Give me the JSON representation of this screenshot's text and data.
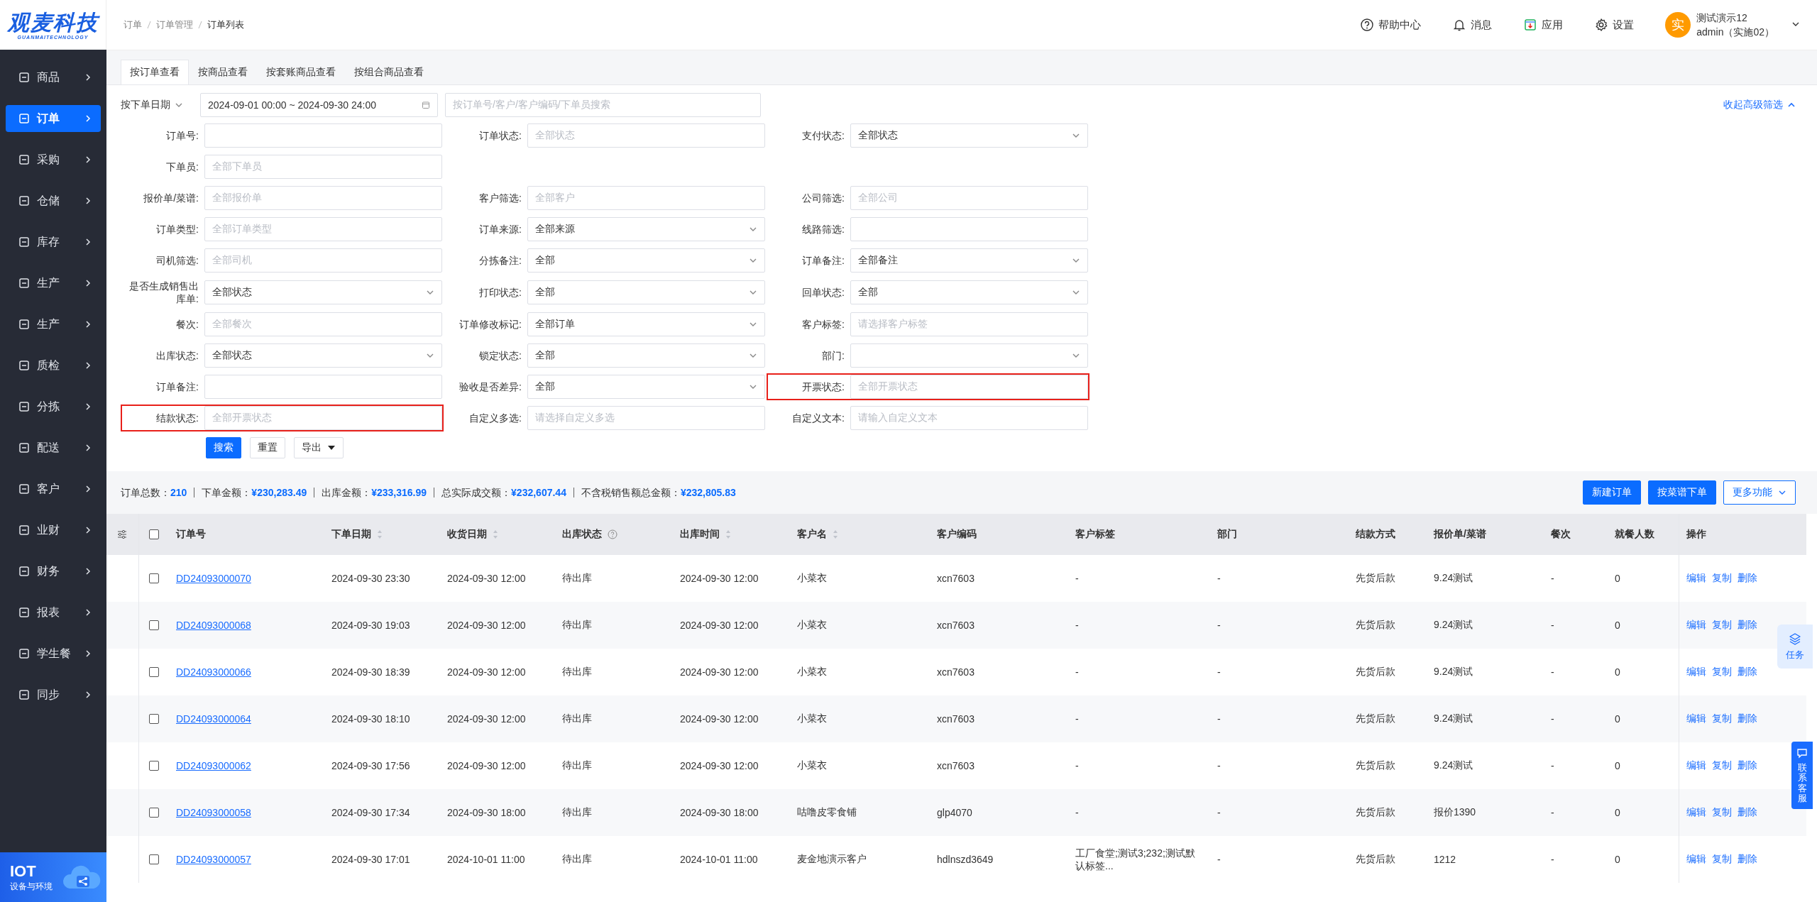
{
  "logo": {
    "title": "观麦科技",
    "subtitle": "GUANMAITECHNOLOGY"
  },
  "sidebar": {
    "items": [
      {
        "label": "商品",
        "selected": false
      },
      {
        "label": "订单",
        "selected": true
      },
      {
        "label": "采购",
        "selected": false
      },
      {
        "label": "仓储",
        "selected": false
      },
      {
        "label": "库存",
        "selected": false
      },
      {
        "label": "生产",
        "selected": false
      },
      {
        "label": "生产",
        "selected": false
      },
      {
        "label": "质检",
        "selected": false
      },
      {
        "label": "分拣",
        "selected": false
      },
      {
        "label": "配送",
        "selected": false
      },
      {
        "label": "客户",
        "selected": false
      },
      {
        "label": "业财",
        "selected": false
      },
      {
        "label": "财务",
        "selected": false
      },
      {
        "label": "报表",
        "selected": false
      },
      {
        "label": "学生餐",
        "selected": false
      },
      {
        "label": "同步",
        "selected": false
      }
    ],
    "iot": {
      "title": "IOT",
      "subtitle": "设备与环境"
    }
  },
  "breadcrumbs": [
    "订单",
    "订单管理",
    "订单列表"
  ],
  "header_actions": [
    {
      "kind": "help",
      "label": "帮助中心"
    },
    {
      "kind": "bell",
      "label": "消息"
    },
    {
      "kind": "app",
      "label": "应用"
    },
    {
      "kind": "gear",
      "label": "设置"
    }
  ],
  "user": {
    "avatar": "实",
    "name": "测试演示12",
    "account": "admin（实施02）"
  },
  "tabs": [
    {
      "label": "按订单查看",
      "selected": true
    },
    {
      "label": "按商品查看",
      "selected": false
    },
    {
      "label": "按套账商品查看",
      "selected": false
    },
    {
      "label": "按组合商品查看",
      "selected": false
    }
  ],
  "search_bar": {
    "date_type": "按下单日期",
    "date_range": "2024-09-01 00:00 ~ 2024-09-30 24:00",
    "placeholder": "按订单号/客户/客户编码/下单员搜索",
    "collapse_link": "收起高级筛选"
  },
  "filters": {
    "rows": [
      {
        "fields": [
          {
            "label": "订单号:",
            "kind": "input",
            "highlighted": false
          },
          {
            "label": "订单状态:",
            "kind": "input",
            "placeholder": "全部状态",
            "highlighted": false
          },
          {
            "label": "支付状态:",
            "kind": "select",
            "value": "全部状态",
            "highlighted": false
          }
        ]
      },
      {
        "fields": [
          {
            "label": "下单员:",
            "kind": "input",
            "placeholder": "全部下单员",
            "highlighted": false
          }
        ]
      },
      {
        "fields": [
          {
            "label": "报价单/菜谱:",
            "kind": "input",
            "placeholder": "全部报价单",
            "highlighted": false
          },
          {
            "label": "客户筛选:",
            "kind": "input",
            "placeholder": "全部客户",
            "highlighted": false
          },
          {
            "label": "公司筛选:",
            "kind": "input",
            "placeholder": "全部公司",
            "highlighted": false
          }
        ]
      },
      {
        "fields": [
          {
            "label": "订单类型:",
            "kind": "input",
            "placeholder": "全部订单类型",
            "highlighted": false
          },
          {
            "label": "订单来源:",
            "kind": "select",
            "value": "全部来源",
            "highlighted": false
          },
          {
            "label": "线路筛选:",
            "kind": "input",
            "highlighted": false
          }
        ]
      },
      {
        "fields": [
          {
            "label": "司机筛选:",
            "kind": "input",
            "placeholder": "全部司机",
            "highlighted": false
          },
          {
            "label": "分拣备注:",
            "kind": "select",
            "value": "全部",
            "highlighted": false
          },
          {
            "label": "订单备注:",
            "kind": "select",
            "value": "全部备注",
            "highlighted": false
          }
        ]
      },
      {
        "fields": [
          {
            "label": "是否生成销售出库单:",
            "kind": "select",
            "value": "全部状态",
            "highlighted": false
          },
          {
            "label": "打印状态:",
            "kind": "select",
            "value": "全部",
            "highlighted": false
          },
          {
            "label": "回单状态:",
            "kind": "select",
            "value": "全部",
            "highlighted": false
          }
        ]
      },
      {
        "fields": [
          {
            "label": "餐次:",
            "kind": "input",
            "placeholder": "全部餐次",
            "highlighted": false
          },
          {
            "label": "订单修改标记:",
            "kind": "select",
            "value": "全部订单",
            "highlighted": false
          },
          {
            "label": "客户标签:",
            "kind": "input",
            "placeholder": "请选择客户标签",
            "highlighted": false
          }
        ]
      },
      {
        "fields": [
          {
            "label": "出库状态:",
            "kind": "select",
            "value": "全部状态",
            "highlighted": false
          },
          {
            "label": "锁定状态:",
            "kind": "select",
            "value": "全部",
            "highlighted": false
          },
          {
            "label": "部门:",
            "kind": "select",
            "highlighted": false
          }
        ]
      },
      {
        "fields": [
          {
            "label": "订单备注:",
            "kind": "input",
            "highlighted": false
          },
          {
            "label": "验收是否差异:",
            "kind": "select",
            "value": "全部",
            "highlighted": false
          },
          {
            "label": "开票状态:",
            "kind": "input",
            "placeholder": "全部开票状态",
            "highlighted": true
          }
        ]
      },
      {
        "fields": [
          {
            "label": "结款状态:",
            "kind": "input",
            "placeholder": "全部开票状态",
            "highlighted": true
          },
          {
            "label": "自定义多选:",
            "kind": "input",
            "placeholder": "请选择自定义多选",
            "highlighted": false
          },
          {
            "label": "自定义文本:",
            "kind": "input",
            "placeholder": "请输入自定义文本",
            "highlighted": false
          }
        ]
      }
    ],
    "buttons": [
      {
        "kind": "primary",
        "label": "搜索"
      },
      {
        "kind": "default",
        "label": "重置"
      },
      {
        "kind": "dropdown",
        "label": "导出"
      }
    ]
  },
  "summary": [
    {
      "label": "订单总数：",
      "value": "210"
    },
    {
      "label": "下单金额：",
      "value": "¥230,283.49"
    },
    {
      "label": "出库金额：",
      "value": "¥233,316.99"
    },
    {
      "label": "总实际成交额：",
      "value": "¥232,607.44"
    },
    {
      "label": "不含税销售额总金额：",
      "value": "¥232,805.83"
    }
  ],
  "toolbar_buttons": [
    {
      "kind": "primary",
      "label": "新建订单"
    },
    {
      "kind": "primary",
      "label": "按菜谱下单"
    },
    {
      "kind": "outline",
      "label": "更多功能"
    }
  ],
  "table": {
    "select_all_checked": false,
    "columns": [
      {
        "label": "订单号",
        "sortable": false,
        "help": false
      },
      {
        "label": "下单日期",
        "sortable": true,
        "help": false
      },
      {
        "label": "收货日期",
        "sortable": true,
        "help": false
      },
      {
        "label": "出库状态",
        "sortable": false,
        "help": true
      },
      {
        "label": "出库时间",
        "sortable": true,
        "help": false
      },
      {
        "label": "客户名",
        "sortable": true,
        "help": false
      },
      {
        "label": "客户编码",
        "sortable": false,
        "help": false
      },
      {
        "label": "客户标签",
        "sortable": false,
        "help": false
      },
      {
        "label": "部门",
        "sortable": false,
        "help": false
      },
      {
        "label": "结款方式",
        "sortable": false,
        "help": false
      },
      {
        "label": "报价单/菜谱",
        "sortable": false,
        "help": false
      },
      {
        "label": "餐次",
        "sortable": false,
        "help": false
      },
      {
        "label": "就餐人数",
        "sortable": false,
        "help": false
      },
      {
        "label": "操作",
        "sortable": false,
        "help": false
      }
    ],
    "rows": [
      {
        "checked": false,
        "actions": [
          "编辑",
          "复制",
          "删除"
        ],
        "cells": [
          "DD24093000070",
          "2024-09-30 23:30",
          "2024-09-30 12:00",
          "待出库",
          "2024-09-30 12:00",
          "小菜衣",
          "xcn7603",
          "-",
          "-",
          "先货后款",
          "9.24测试",
          "-",
          "0"
        ]
      },
      {
        "checked": false,
        "actions": [
          "编辑",
          "复制",
          "删除"
        ],
        "cells": [
          "DD24093000068",
          "2024-09-30 19:03",
          "2024-09-30 12:00",
          "待出库",
          "2024-09-30 12:00",
          "小菜衣",
          "xcn7603",
          "-",
          "-",
          "先货后款",
          "9.24测试",
          "-",
          "0"
        ]
      },
      {
        "checked": false,
        "actions": [
          "编辑",
          "复制",
          "删除"
        ],
        "cells": [
          "DD24093000066",
          "2024-09-30 18:39",
          "2024-09-30 12:00",
          "待出库",
          "2024-09-30 12:00",
          "小菜衣",
          "xcn7603",
          "-",
          "-",
          "先货后款",
          "9.24测试",
          "-",
          "0"
        ]
      },
      {
        "checked": false,
        "actions": [
          "编辑",
          "复制",
          "删除"
        ],
        "cells": [
          "DD24093000064",
          "2024-09-30 18:10",
          "2024-09-30 12:00",
          "待出库",
          "2024-09-30 12:00",
          "小菜衣",
          "xcn7603",
          "-",
          "-",
          "先货后款",
          "9.24测试",
          "-",
          "0"
        ]
      },
      {
        "checked": false,
        "actions": [
          "编辑",
          "复制",
          "删除"
        ],
        "cells": [
          "DD24093000062",
          "2024-09-30 17:56",
          "2024-09-30 12:00",
          "待出库",
          "2024-09-30 12:00",
          "小菜衣",
          "xcn7603",
          "-",
          "-",
          "先货后款",
          "9.24测试",
          "-",
          "0"
        ]
      },
      {
        "checked": false,
        "actions": [
          "编辑",
          "复制",
          "删除"
        ],
        "cells": [
          "DD24093000058",
          "2024-09-30 17:34",
          "2024-09-30 18:00",
          "待出库",
          "2024-09-30 18:00",
          "咕噜皮零食铺",
          "glp4070",
          "-",
          "-",
          "先货后款",
          "报价1390",
          "-",
          "0"
        ]
      },
      {
        "checked": false,
        "actions": [
          "编辑",
          "复制",
          "删除"
        ],
        "cells": [
          "DD24093000057",
          "2024-09-30 17:01",
          "2024-10-01 11:00",
          "待出库",
          "2024-10-01 11:00",
          "麦金地演示客户",
          "hdlnszd3649",
          "工厂食堂;测试3;232;测试默认标签...",
          "-",
          "先货后款",
          "1212",
          "-",
          "0"
        ]
      }
    ]
  },
  "floating": {
    "task": "任务",
    "support": "联系客服"
  }
}
